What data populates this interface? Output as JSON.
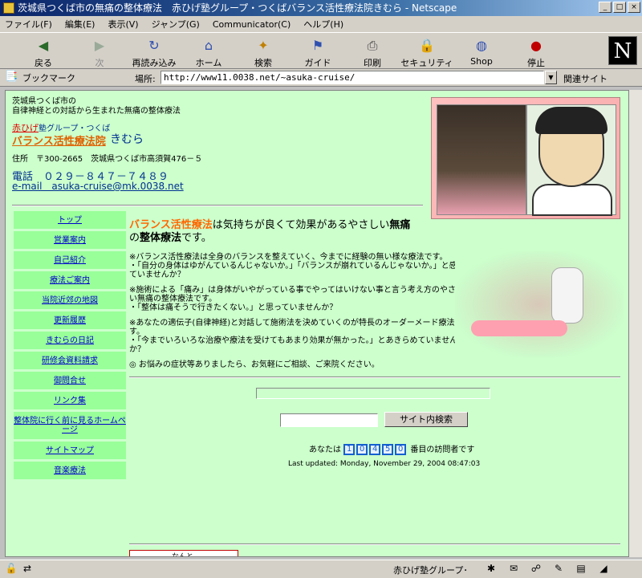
{
  "window": {
    "title": "茨城県つくば市の無痛の整体療法　赤ひげ塾グループ・つくばバランス活性療法院きむら - Netscape"
  },
  "menu": [
    "ファイル(F)",
    "編集(E)",
    "表示(V)",
    "ジャンプ(G)",
    "Communicator(C)",
    "ヘルプ(H)"
  ],
  "toolbar": {
    "back": "戻る",
    "forward": "次",
    "reload": "再読み込み",
    "home": "ホーム",
    "search": "検索",
    "guide": "ガイド",
    "print": "印刷",
    "security": "セキュリティ",
    "shop": "Shop",
    "stop": "停止"
  },
  "location": {
    "bookmarks": "ブックマーク",
    "label": "場所:",
    "url": "http://www11.0038.net/~asuka-cruise/",
    "related": "関連サイト"
  },
  "header": {
    "line1": "茨城県つくば市の",
    "line2": "自律神経との対話から生まれた無痛の整体療法",
    "group_a": "赤ひげ",
    "group_b": "塾グループ・つくば",
    "clinic": "バランス活性療法院",
    "clinic_suffix": "きむら",
    "address": "住所　〒300-2665　茨城県つくば市高須賀476－５",
    "phone": "電話　０２９－８４７－７４８９",
    "email": "e-mail　asuka-cruise@mk.0038.net"
  },
  "nav": [
    "トップ",
    "営業案内",
    "自己紹介",
    "療法ご案内",
    "当院近郊の地図",
    "更新履歴",
    "きむらの日記",
    "研修会資料請求",
    "御問合せ",
    "リンク集",
    "整体院に行く前に見るホームページ",
    "サイトマップ",
    "音楽療法"
  ],
  "intro": {
    "em": "バランス活性療法",
    "mid": "は気持ちが良くて効果があるやさしい",
    "b1": "無痛",
    "b2": "の",
    "b3": "整体療法",
    "end": "です。"
  },
  "bullets": [
    "※バランス活性療法は全身のバランスを整えていく、今までに経験の無い様な療法です。",
    "・「自分の身体はゆがんているんじゃないか。」「バランスが崩れているんじゃないか。」と感じていませんか？",
    "※施術による「痛み」は身体がいやがっている事でやってはいけない事と言う考え方のやさしい無痛の整体療法です。",
    "・「整体は痛そうで行きたくない。」と思っていませんか？",
    "※あなたの適伝子(自律神経)と対話して施術法を決めていくのが特長のオーダーメード療法です。",
    "・「今までいろいろな治療や療法を受けてもあまり効果が無かった。」とあきらめていませんか？",
    "◎ お悩みの症状等ありましたら、お気軽にご相談、ご来院ください。"
  ],
  "search": {
    "button": "サイト内検索",
    "value": ""
  },
  "counter": {
    "prefix": "あなたは",
    "digits": [
      "1",
      "0",
      "4",
      "5",
      "0"
    ],
    "suffix": "番目の訪問者です"
  },
  "updated": "Last updated: Monday, November 29, 2004 08:47:03",
  "bottom_label": "なんと",
  "status": {
    "text": "赤ひげ塾グループ･"
  }
}
